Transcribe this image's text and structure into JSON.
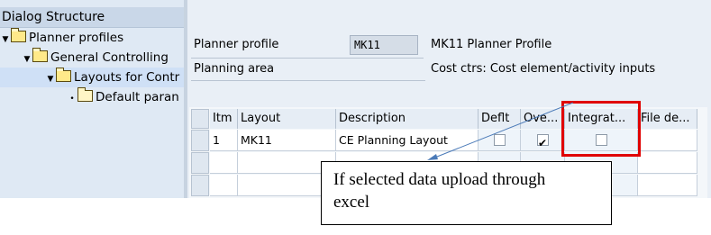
{
  "dialog_structure": {
    "title": "Dialog Structure",
    "items": [
      {
        "label": "Planner profiles"
      },
      {
        "label": "General Controlling"
      },
      {
        "label": "Layouts for Contr"
      },
      {
        "label": "Default paran"
      }
    ]
  },
  "form": {
    "planner_profile_label": "Planner profile",
    "planner_profile_value": "MK11",
    "planner_profile_desc": "MK11 Planner Profile",
    "planning_area_label": "Planning area",
    "planning_area_desc": "Cost ctrs: Cost element/activity inputs"
  },
  "table": {
    "headers": [
      "Itm",
      "Layout",
      "Description",
      "Deflt",
      "Ove...",
      "Integrat...",
      "File de..."
    ],
    "rows": [
      {
        "itm": "1",
        "layout": "MK11",
        "description": "CE Planning Layout",
        "deflt": false,
        "ove": true,
        "integrat": false,
        "file": ""
      }
    ]
  },
  "annotation": {
    "text_line1": "If selected data upload through",
    "text_line2": "excel",
    "highlight_color": "#e00000"
  }
}
